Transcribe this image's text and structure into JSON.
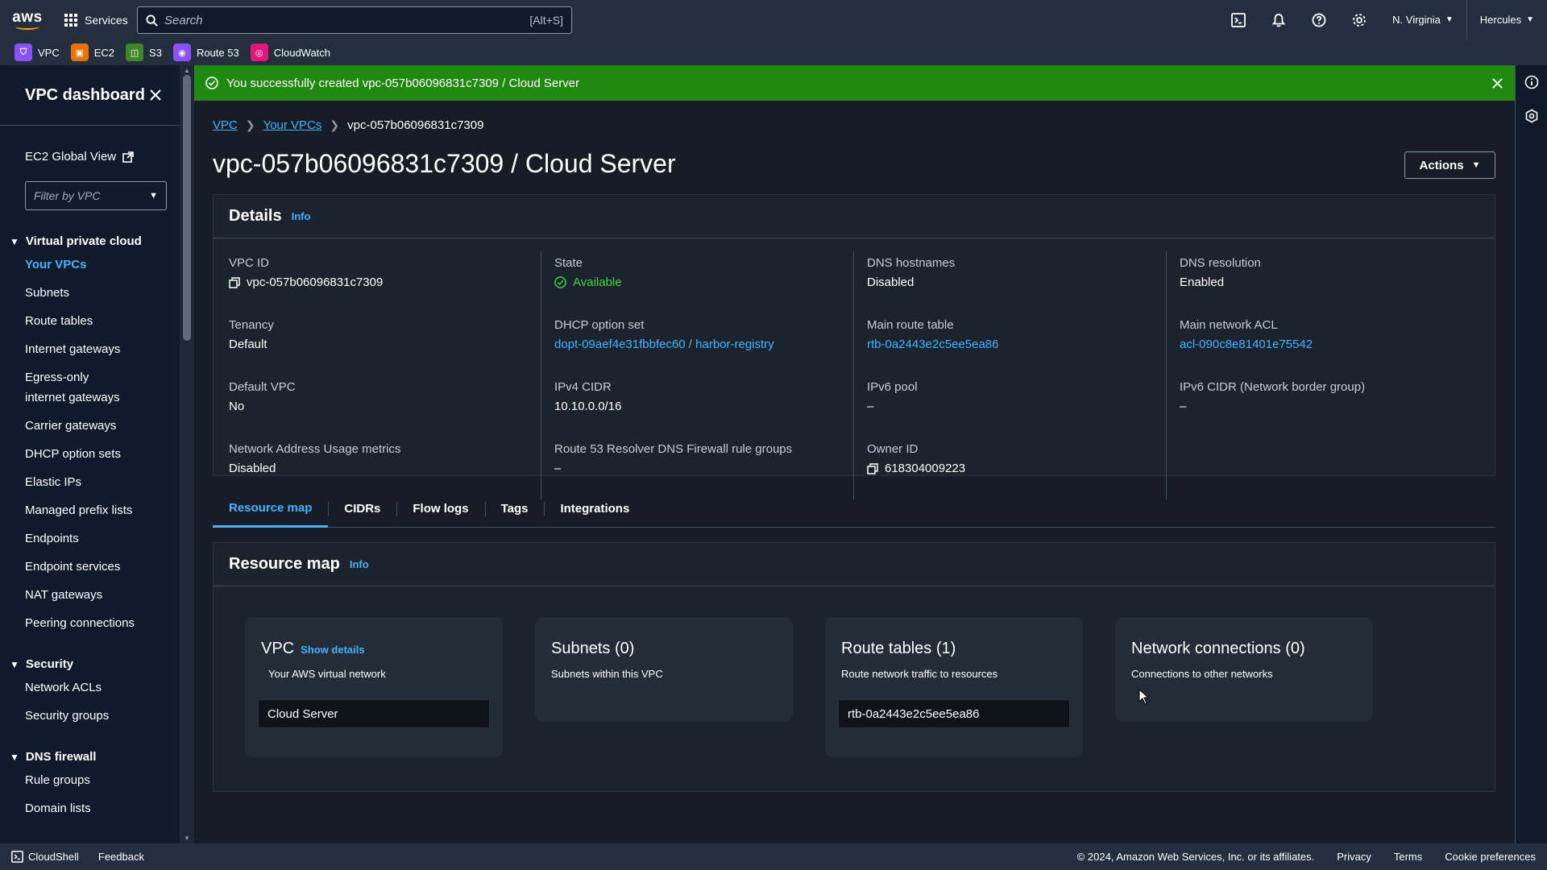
{
  "topnav": {
    "logo": "aws",
    "services": "Services",
    "search_placeholder": "Search",
    "search_shortcut": "[Alt+S]",
    "region": "N. Virginia",
    "user": "Hercules"
  },
  "favorites": [
    {
      "label": "VPC",
      "color": "#8c4fff"
    },
    {
      "label": "EC2",
      "color": "#ed7100"
    },
    {
      "label": "S3",
      "color": "#3f8624"
    },
    {
      "label": "Route 53",
      "color": "#8c4fff"
    },
    {
      "label": "CloudWatch",
      "color": "#e7157b"
    }
  ],
  "sidebar": {
    "title": "VPC dashboard",
    "global_view": "EC2 Global View",
    "filter_placeholder": "Filter by VPC",
    "sections": [
      {
        "title": "Virtual private cloud",
        "items": [
          "Your VPCs",
          "Subnets",
          "Route tables",
          "Internet gateways",
          "Egress-only internet gateways",
          "Carrier gateways",
          "DHCP option sets",
          "Elastic IPs",
          "Managed prefix lists",
          "Endpoints",
          "Endpoint services",
          "NAT gateways",
          "Peering connections"
        ]
      },
      {
        "title": "Security",
        "items": [
          "Network ACLs",
          "Security groups"
        ]
      },
      {
        "title": "DNS firewall",
        "items": [
          "Rule groups",
          "Domain lists"
        ]
      }
    ]
  },
  "flash": {
    "message": "You successfully created vpc-057b06096831c7309 / Cloud Server"
  },
  "breadcrumb": {
    "root": "VPC",
    "parent": "Your VPCs",
    "current": "vpc-057b06096831c7309"
  },
  "page": {
    "title": "vpc-057b06096831c7309 / Cloud Server",
    "actions": "Actions"
  },
  "details": {
    "title": "Details",
    "info": "Info",
    "columns": [
      [
        {
          "label": "VPC ID",
          "value": "vpc-057b06096831c7309",
          "copy": true
        },
        {
          "label": "Tenancy",
          "value": "Default"
        },
        {
          "label": "Default VPC",
          "value": "No"
        },
        {
          "label": "Network Address Usage metrics",
          "value": "Disabled"
        }
      ],
      [
        {
          "label": "State",
          "value": "Available",
          "status": "ok"
        },
        {
          "label": "DHCP option set",
          "value": "dopt-09aef4e31fbbfec60 / harbor-registry",
          "link": true
        },
        {
          "label": "IPv4 CIDR",
          "value": "10.10.0.0/16"
        },
        {
          "label": "Route 53 Resolver DNS Firewall rule groups",
          "value": "–"
        }
      ],
      [
        {
          "label": "DNS hostnames",
          "value": "Disabled"
        },
        {
          "label": "Main route table",
          "value": "rtb-0a2443e2c5ee5ea86",
          "link": true
        },
        {
          "label": "IPv6 pool",
          "value": "–"
        },
        {
          "label": "Owner ID",
          "value": "618304009223",
          "copy": true
        }
      ],
      [
        {
          "label": "DNS resolution",
          "value": "Enabled"
        },
        {
          "label": "Main network ACL",
          "value": "acl-090c8e81401e75542",
          "link": true
        },
        {
          "label": "IPv6 CIDR (Network border group)",
          "value": "–"
        }
      ]
    ]
  },
  "tabs": [
    "Resource map",
    "CIDRs",
    "Flow logs",
    "Tags",
    "Integrations"
  ],
  "resource_map": {
    "title": "Resource map",
    "info": "Info",
    "cards": [
      {
        "title": "VPC",
        "link": "Show details",
        "subtitle": "Your AWS virtual network",
        "chip": "Cloud Server"
      },
      {
        "title": "Subnets (0)",
        "subtitle": "Subnets within this VPC"
      },
      {
        "title": "Route tables (1)",
        "subtitle": "Route network traffic to resources",
        "chip": "rtb-0a2443e2c5ee5ea86"
      },
      {
        "title": "Network connections (0)",
        "subtitle": "Connections to other networks"
      }
    ]
  },
  "footer": {
    "cloudshell": "CloudShell",
    "feedback": "Feedback",
    "copyright": "© 2024, Amazon Web Services, Inc. or its affiliates.",
    "privacy": "Privacy",
    "terms": "Terms",
    "cookies": "Cookie preferences"
  },
  "colors": {
    "accent": "#42b4ff",
    "success": "#1f8a0f",
    "available": "#3ed63e",
    "background": "#161d26"
  }
}
